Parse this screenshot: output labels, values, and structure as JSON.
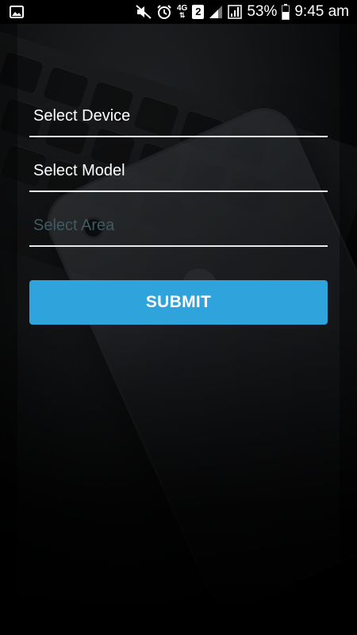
{
  "status_bar": {
    "battery_percent": "53%",
    "time": "9:45 am",
    "network_label": "4G",
    "sim_number": "2",
    "icons": [
      "image-icon",
      "mute-icon",
      "alarm-icon",
      "network-4g-icon",
      "sim-icon",
      "signal-icon",
      "battery-icon"
    ]
  },
  "form": {
    "device_field": "Select Device",
    "model_field": "Select Model",
    "area_field": "Select Area",
    "submit_label": "SUBMIT"
  },
  "colors": {
    "accent": "#2ea3dc",
    "placeholder": "#3f5a63",
    "underline": "#e8e8e8"
  }
}
